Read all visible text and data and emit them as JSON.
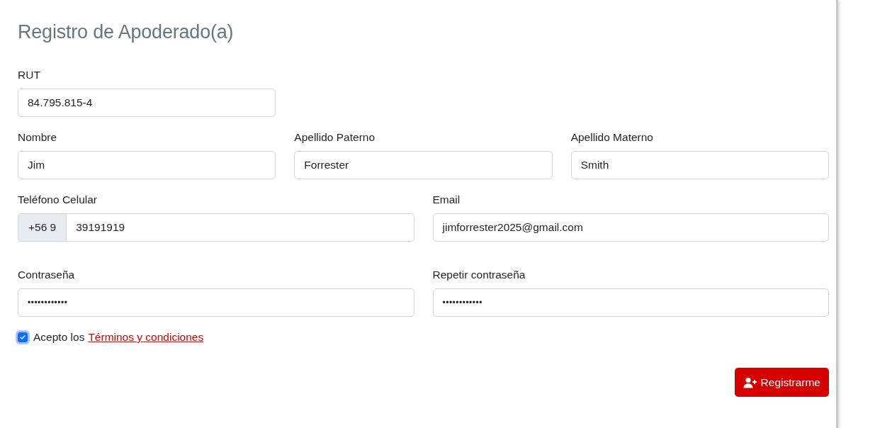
{
  "title": "Registro de Apoderado(a)",
  "rows": [
    {
      "fields": [
        {
          "label": "RUT",
          "value": "84.795.815-4",
          "kind": "text"
        }
      ]
    },
    {
      "fields": [
        {
          "label": "Nombre",
          "value": "Jim",
          "kind": "text"
        },
        {
          "label": "Apellido Paterno",
          "value": "Forrester",
          "kind": "text"
        },
        {
          "label": "Apellido Materno",
          "value": "Smith",
          "kind": "text"
        }
      ]
    },
    {
      "fields": [
        {
          "label": "Teléfono Celular",
          "prefix": "+56 9",
          "value": "39191919",
          "kind": "text"
        },
        {
          "label": "Email",
          "value": "jimforrester2025@gmail.com",
          "kind": "text"
        }
      ]
    },
    {
      "fields": [
        {
          "label": "Contraseña",
          "value": "••••••••••••",
          "kind": "password"
        },
        {
          "label": "Repetir contraseña",
          "value": "••••••••••••",
          "kind": "password"
        }
      ]
    }
  ],
  "terms": {
    "checked": true,
    "text": "Acepto los",
    "link": "Términos y condiciones"
  },
  "submit": {
    "label": "Registrarme"
  }
}
